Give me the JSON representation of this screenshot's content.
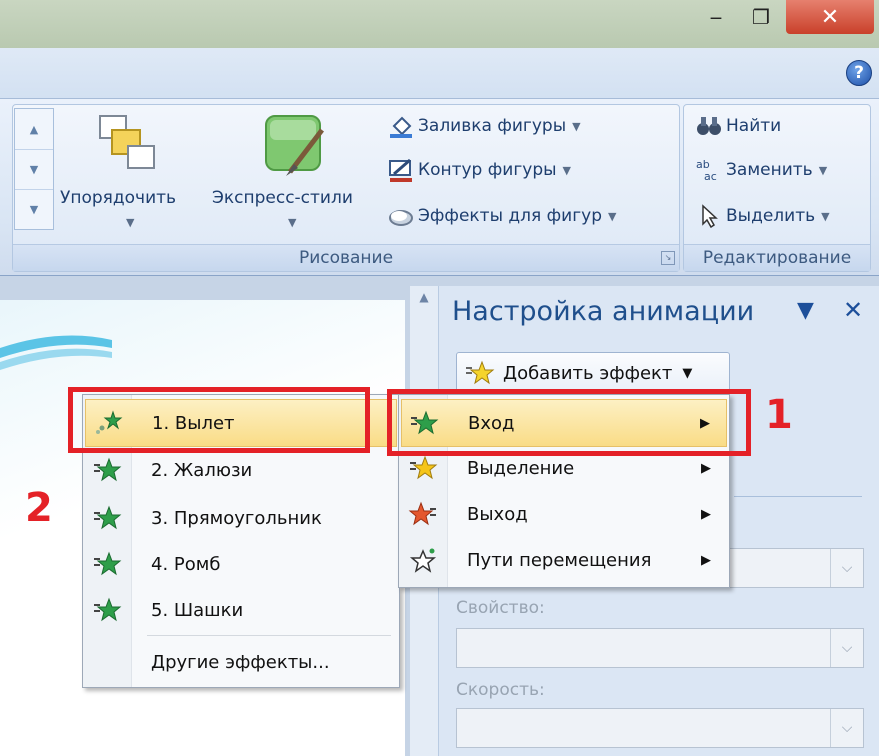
{
  "window": {
    "minimize_glyph": "‒",
    "maximize_glyph": "❐",
    "close_glyph": "✕",
    "help_glyph": "?"
  },
  "ribbon": {
    "drawing_group": {
      "label": "Рисование",
      "arrange_label": "Упорядочить",
      "quick_styles_label": "Экспресс-стили",
      "shape_fill_label": "Заливка фигуры",
      "shape_outline_label": "Контур фигуры",
      "shape_effects_label": "Эффекты для фигур"
    },
    "editing_group": {
      "label": "Редактирование",
      "find_label": "Найти",
      "replace_label": "Заменить",
      "select_label": "Выделить"
    }
  },
  "task_pane": {
    "title": "Настройка анимации",
    "add_effect_label": "Добавить эффект",
    "property_label": "Свойство:",
    "speed_label": "Скорость:"
  },
  "effect_menu": {
    "items": [
      {
        "label": "Вход",
        "highlighted": true
      },
      {
        "label": "Выделение"
      },
      {
        "label": "Выход"
      },
      {
        "label": "Пути перемещения"
      }
    ]
  },
  "entrance_submenu": {
    "items": [
      {
        "label": "1. Вылет",
        "highlighted": true
      },
      {
        "label": "2. Жалюзи"
      },
      {
        "label": "3. Прямоугольник"
      },
      {
        "label": "4. Ромб"
      },
      {
        "label": "5. Шашки"
      }
    ],
    "more_label": "Другие эффекты..."
  },
  "annotations": {
    "marker_1": "1",
    "marker_2": "2",
    "color": "#e42127"
  },
  "colors": {
    "highlight": "#f9dc86",
    "ribbon_text": "#1e3e6e",
    "pane_title": "#1f4f8c"
  }
}
